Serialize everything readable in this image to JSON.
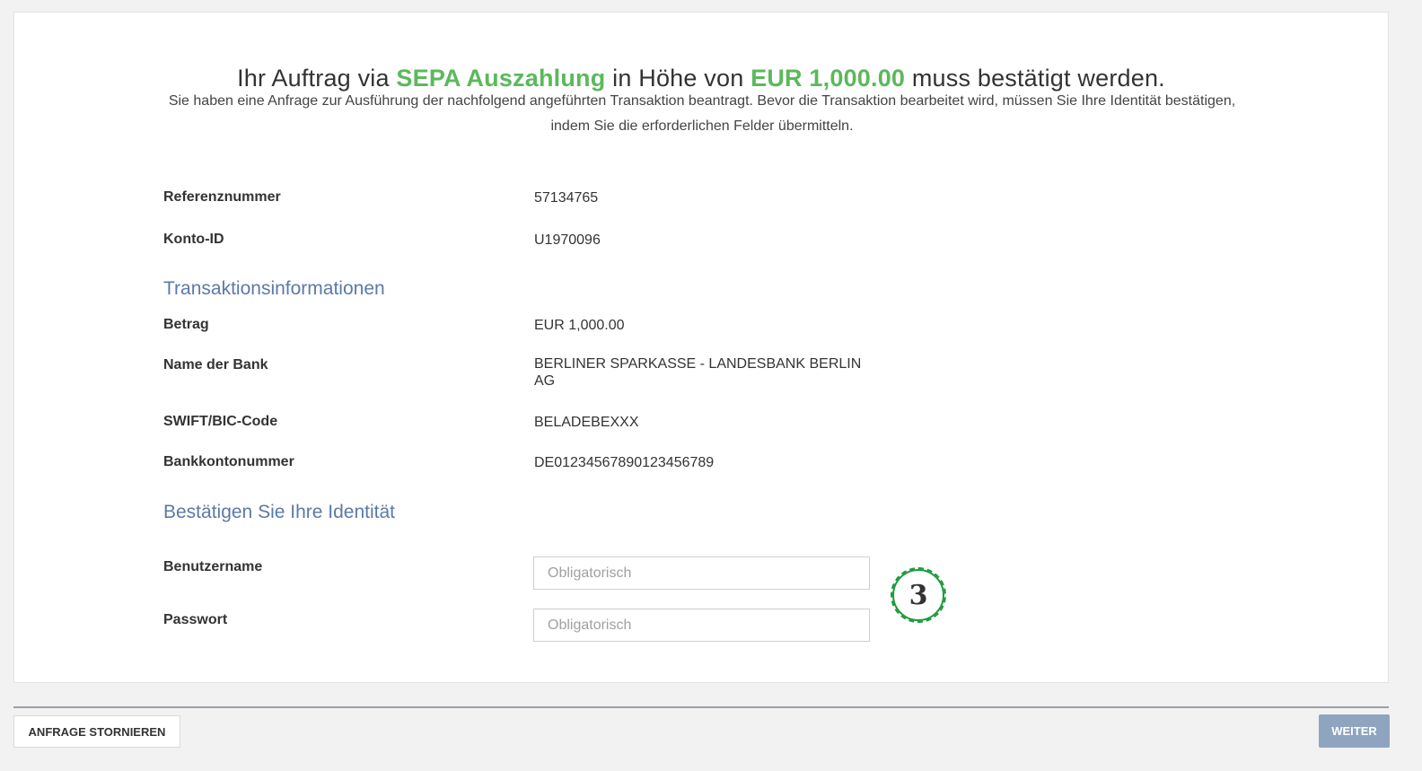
{
  "header": {
    "prefix": "Ihr Auftrag via ",
    "method": "SEPA Auszahlung",
    "middle": " in Höhe von ",
    "amount": "EUR 1,000.00",
    "suffix": " muss bestätigt werden.",
    "description": "Sie haben eine Anfrage zur Ausführung der nachfolgend angeführten Transaktion beantragt. Bevor die Transaktion bearbeitet wird, müssen Sie Ihre Identität bestätigen, indem Sie die erforderlichen Felder übermitteln."
  },
  "reference": {
    "label": "Referenznummer",
    "value": "57134765"
  },
  "account": {
    "label": "Konto-ID",
    "value": "U1970096"
  },
  "transaction": {
    "heading": "Transaktionsinformationen",
    "rows": [
      {
        "label": "Betrag",
        "value": "EUR 1,000.00"
      },
      {
        "label": "Name der Bank",
        "value": "BERLINER SPARKASSE - LANDESBANK BERLIN AG"
      },
      {
        "label": "SWIFT/BIC-Code",
        "value": "BELADEBEXXX"
      },
      {
        "label": "Bankkontonummer",
        "value": "DE01234567890123456789"
      }
    ]
  },
  "identity": {
    "heading": "Bestätigen Sie Ihre Identität",
    "username": {
      "label": "Benutzername",
      "placeholder": "Obligatorisch",
      "value": ""
    },
    "password": {
      "label": "Passwort",
      "placeholder": "Obligatorisch",
      "value": ""
    }
  },
  "step_badge": "3",
  "footer": {
    "cancel_label": "ANFRAGE STORNIEREN",
    "next_label": "WEITER"
  },
  "colors": {
    "highlight": "#5cb85c",
    "section": "#5b7aa8",
    "primary_button": "#8fa4bf",
    "badge": "#1c9a3c"
  }
}
